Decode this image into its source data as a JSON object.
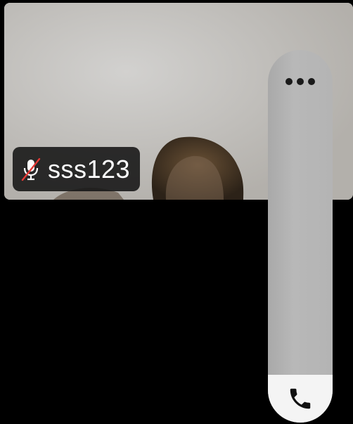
{
  "participant": {
    "name": "sss123",
    "mic_state": "muted",
    "mic_icon": "mic-off-icon"
  },
  "controls": {
    "more_icon": "more-horizontal-icon",
    "end_call_icon": "phone-icon"
  },
  "colors": {
    "mute_slash": "#e53935",
    "panel": "#b4b4b4",
    "end_call_bg": "#f4f4f4",
    "chip_bg": "#141414"
  }
}
